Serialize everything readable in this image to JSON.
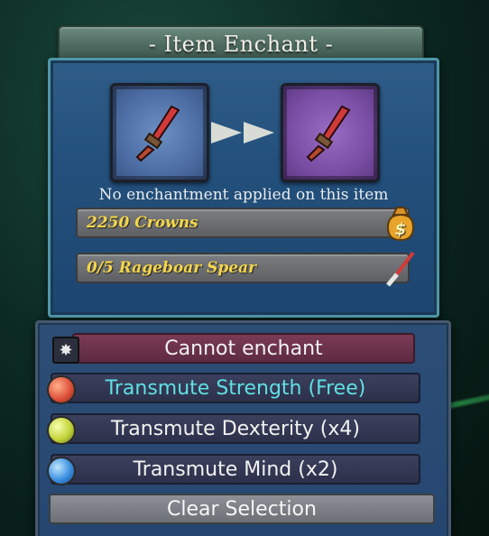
{
  "title": "- Item Enchant -",
  "status_text": "No enchantment applied on this item",
  "cost": {
    "crowns_label": "2250 Crowns",
    "material_label": "0/5 Rageboar Spear"
  },
  "options": {
    "cannot": "Cannot enchant",
    "strength": "Transmute Strength (Free)",
    "dexterity": "Transmute Dexterity (x4)",
    "mind": "Transmute Mind (x2)",
    "clear": "Clear Selection"
  },
  "colors": {
    "accent_text_cyan": "#5fe0e4",
    "gold_text": "#f5d64a",
    "panel_blue": "#23507c",
    "cannot_bg": "#7a3b55"
  },
  "icons": {
    "slot_left": "spear-icon",
    "slot_right": "spear-icon",
    "crowns": "money-bag-icon",
    "material": "spear-material-icon",
    "cannot": "burst-icon",
    "strength": "red-gem-icon",
    "dexterity": "yellow-gem-icon",
    "mind": "blue-gem-icon"
  }
}
